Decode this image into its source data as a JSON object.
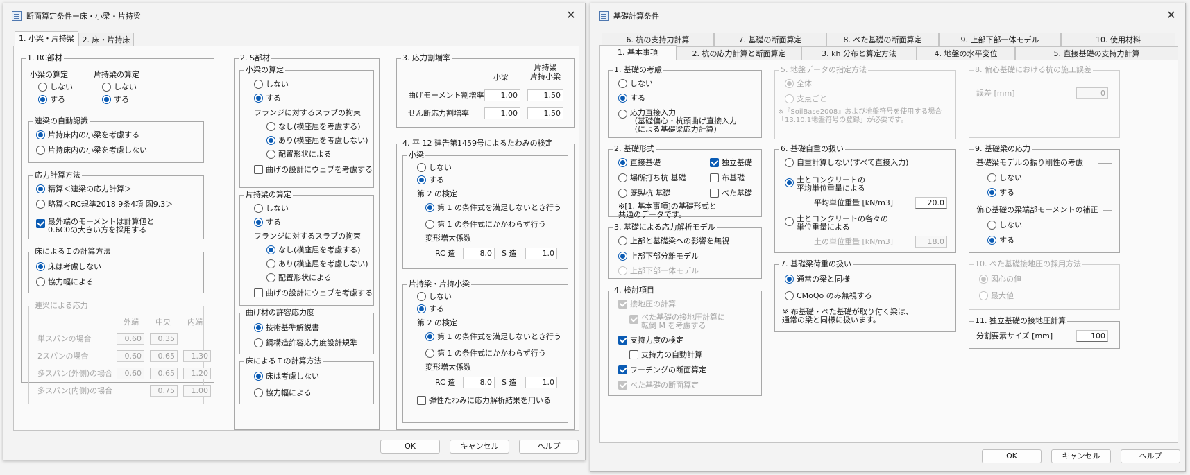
{
  "left": {
    "title": "断面算定条件ー床・小梁・片持梁",
    "tabs": [
      "1. 小梁・片持梁",
      "2. 床・片持床"
    ],
    "rc": {
      "title": "1. RC部材",
      "kobari_hd": "小梁の算定",
      "kata_hd": "片持梁の算定",
      "no": "しない",
      "yes": "する",
      "ren": {
        "title": "連梁の自動認識",
        "o1": "片持床内の小梁を考慮する",
        "o2": "片持床内の小梁を考慮しない"
      },
      "calc": {
        "title": "応力計算方法",
        "o1": "精算＜連梁の応力計算＞",
        "o2": "略算＜RC規準2018 9条4項 図9.3＞",
        "cb": "最外端のモーメントは計算値と\n0.6C0の大きい方を採用する"
      },
      "floor": {
        "title": "床によるＩの計算方法",
        "o1": "床は考慮しない",
        "o2": "協力幅による"
      },
      "renst": {
        "title": "連梁による応力",
        "h1": "外端",
        "h2": "中央",
        "h3": "内端",
        "rows": [
          {
            "label": "単スパンの場合",
            "v1": "0.60",
            "v2": "0.35",
            "v3": ""
          },
          {
            "label": "2スパンの場合",
            "v1": "0.60",
            "v2": "0.65",
            "v3": "1.30"
          },
          {
            "label": "多スパン(外側)の場合",
            "v1": "0.60",
            "v2": "0.65",
            "v3": "1.20"
          },
          {
            "label": "多スパン(内側)の場合",
            "v1": "",
            "v2": "0.75",
            "v3": "1.00"
          }
        ]
      }
    },
    "s": {
      "title": "2. S部材",
      "kob": {
        "title": "小梁の算定",
        "no": "しない",
        "yes": "する",
        "sub": "フランジに対するスラブの拘束",
        "o1": "なし(横座屈を考慮する)",
        "o2": "あり(横座屈を考慮しない)",
        "o3": "配置形状による",
        "cb": "曲げの設計にウェブを考慮する"
      },
      "kat": {
        "title": "片持梁の算定",
        "no": "しない",
        "yes": "する",
        "sub": "フランジに対するスラブの拘束",
        "o1": "なし(横座屈を考慮する)",
        "o2": "あり(横座屈を考慮しない)",
        "o3": "配置形状による",
        "cb": "曲げの設計にウェブを考慮する"
      },
      "allow": {
        "title": "曲げ材の許容応力度",
        "o1": "技術基準解説書",
        "o2": "鋼構造許容応力度設計規準"
      },
      "floor": {
        "title": "床によるＩの計算方法",
        "o1": "床は考慮しない",
        "o2": "協力幅による"
      }
    },
    "rate": {
      "title": "3. 応力割増率",
      "h1": "小梁",
      "h2": "片持梁\n片持小梁",
      "r1": "曲げモーメント割増率",
      "r2": "せん断応力割増率",
      "v11": "1.00",
      "v12": "1.50",
      "v21": "1.00",
      "v22": "1.50"
    },
    "defl": {
      "title": "4. 平 12 建告第1459号によるたわみの検定",
      "g1": {
        "title": "小梁",
        "no": "しない",
        "yes": "する",
        "second": "第 2 の検定",
        "o1": "第 1 の条件式を満足しないとき行う",
        "o2": "第 1 の条件式にかかわらず行う",
        "factor": "変形増大係数",
        "rc": "RC 造",
        "rcv": "8.0",
        "s": "S 造",
        "sv": "1.0"
      },
      "g2": {
        "title": "片持梁・片持小梁",
        "no": "しない",
        "yes": "する",
        "second": "第 2 の検定",
        "o1": "第 1 の条件式を満足しないとき行う",
        "o2": "第 1 の条件式にかかわらず行う",
        "factor": "変形増大係数",
        "rc": "RC 造",
        "rcv": "8.0",
        "s": "S 造",
        "sv": "1.0"
      },
      "cb": "弾性たわみに応力解析結果を用いる"
    },
    "buttons": {
      "ok": "OK",
      "cancel": "キャンセル",
      "help": "ヘルプ"
    }
  },
  "right": {
    "title": "基礎計算条件",
    "tabs_row1": [
      "6. 杭の支持力計算",
      "7. 基礎の断面算定",
      "8. べた基礎の断面算定",
      "9. 上部下部一体モデル",
      "10. 使用材料"
    ],
    "tabs_row2": [
      "1. 基本事項",
      "2. 杭の応力計算と断面算定",
      "3. kh 分布と算定方法",
      "4. 地盤の水平変位",
      "5. 直接基礎の支持力計算"
    ],
    "g1": {
      "title": "1. 基礎の考慮",
      "o1": "しない",
      "o2": "する",
      "o3": "応力直接入力\n（基礎偏心・杭頭曲げ直接入力\n（による基礎梁応力計算）"
    },
    "g2": {
      "title": "2. 基礎形式",
      "r1": "直接基礎",
      "r2": "場所打ち杭 基礎",
      "r3": "既製杭 基礎",
      "c1": "独立基礎",
      "c2": "布基礎",
      "c3": "べた基礎",
      "note": "※[1. 基本事項]の基礎形式と\n共通のデータです。"
    },
    "g3": {
      "title": "3. 基礎による応力解析モデル",
      "o1": "上部と基礎梁への影響を無視",
      "o2": "上部下部分離モデル",
      "o3": "上部下部一体モデル"
    },
    "g4": {
      "title": "4. 検討項目",
      "c1": "接地圧の計算",
      "c1a": "べた基礎の接地圧計算に\n転倒 M を考慮する",
      "c2": "支持力度の検定",
      "c2a": "支持力の自動計算",
      "c3": "フーチングの断面算定",
      "c4": "べた基礎の断面算定"
    },
    "g5": {
      "title": "5. 地盤データの指定方法",
      "o1": "全体",
      "o2": "支点ごと",
      "note": "※『SoilBase2008』および地盤符号を使用する場合\n「13.10.1地盤符号の登録」が必要です。"
    },
    "g6": {
      "title": "6. 基礎自重の扱い",
      "o1": "自重計算しない(すべて直接入力)",
      "o2": "土とコンクリートの\n平均単位重量による",
      "avg": "平均単位重量 [kN/m3]",
      "avgv": "20.0",
      "o3": "土とコンクリートの各々の\n単位重量による",
      "soil": "土の単位重量 [kN/m3]",
      "soilv": "18.0"
    },
    "g7": {
      "title": "7. 基礎梁荷重の扱い",
      "o1": "通常の梁と同様",
      "o2": "CMoQo のみ無視する",
      "note": "※ 布基礎・べた基礎が取り付く梁は、\n通常の梁と同様に扱います。"
    },
    "g8": {
      "title": "8. 偏心基礎における杭の施工誤差",
      "label": "誤差 [mm]",
      "value": "0"
    },
    "g9": {
      "title": "9. 基礎梁の応力",
      "sub1": "基礎梁モデルの振り剛性の考慮",
      "no": "しない",
      "yes": "する",
      "sub2": "偏心基礎の梁端部モーメントの補正",
      "no2": "しない",
      "yes2": "する"
    },
    "g10": {
      "title": "10. べた基礎接地圧の採用方法",
      "o1": "図心の値",
      "o2": "最大値"
    },
    "g11": {
      "title": "11. 独立基礎の接地圧計算",
      "label": "分割要素サイズ [mm]",
      "value": "100"
    },
    "buttons": {
      "ok": "OK",
      "cancel": "キャンセル",
      "help": "ヘルプ"
    }
  }
}
